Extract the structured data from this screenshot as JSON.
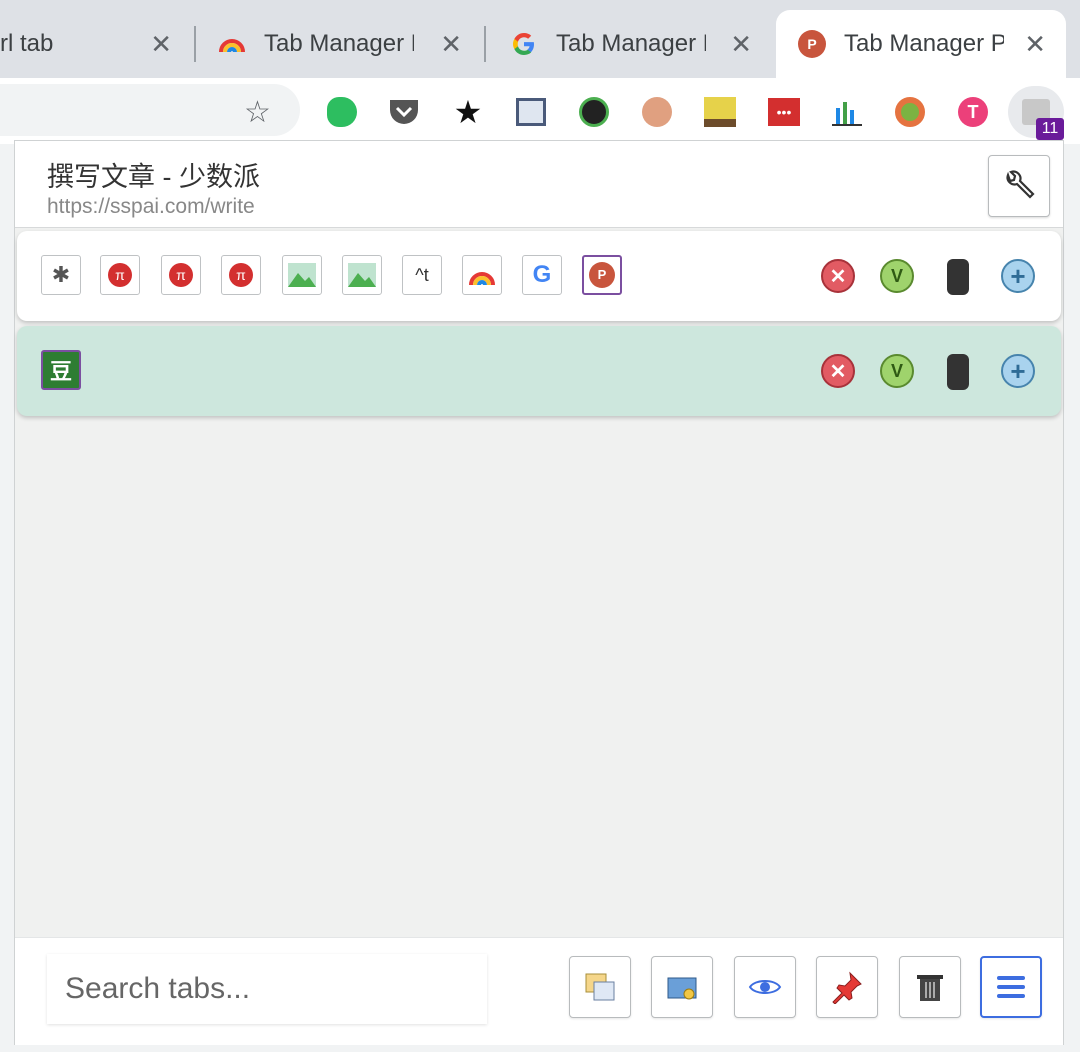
{
  "browser": {
    "tabs": [
      {
        "label": "rl tab",
        "close": "✕"
      },
      {
        "label": "Tab Manager P",
        "close": "✕"
      },
      {
        "label": "Tab Manager P",
        "close": "✕"
      },
      {
        "label": "Tab Manager P",
        "close": "✕",
        "active": true
      }
    ],
    "extension_badge": "11"
  },
  "popup": {
    "page_title": "撰写文章 - 少数派",
    "page_url": "https://sspai.com/write",
    "windows": [
      {
        "tab_icons": [
          "puzzle-icon",
          "pi-icon",
          "pi-icon",
          "pi-icon",
          "image-icon",
          "image-icon",
          "caret-t-icon",
          "rainbow-icon",
          "google-icon",
          "p-icon"
        ],
        "caret_t_text": "^t",
        "selected_tab": 9
      },
      {
        "tab_icons": [
          "douban-icon"
        ],
        "douban_text": "豆"
      }
    ],
    "controls": {
      "close": "✕",
      "minimize": "V",
      "add": "+"
    },
    "search": {
      "placeholder": "Search tabs..."
    }
  },
  "colors": {
    "accent": "#7b4fa0",
    "window_highlight": "#cde7dd",
    "close": "#e25b63",
    "minimize": "#9fd36c",
    "add": "#a9d3ee"
  }
}
